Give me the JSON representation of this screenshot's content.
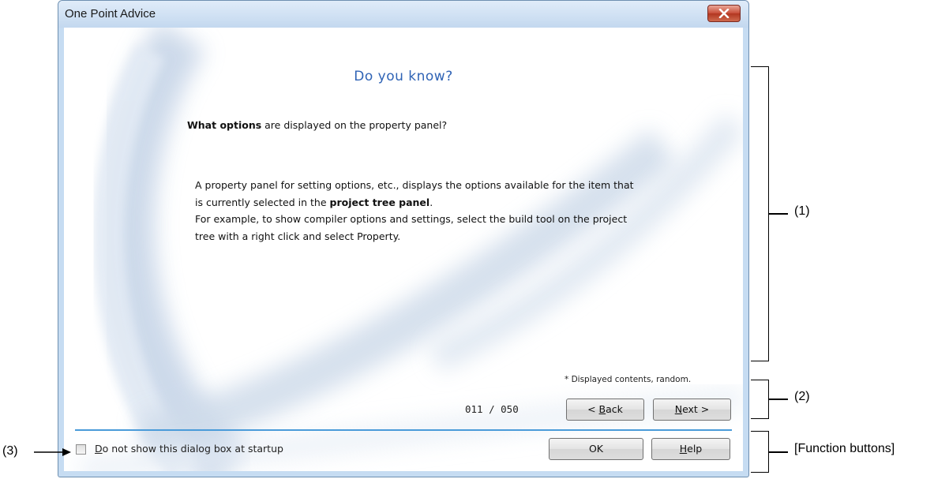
{
  "window": {
    "title": "One Point Advice",
    "close_icon": "close-icon"
  },
  "advice": {
    "heading": "Do you know?",
    "question_bold": "What options",
    "question_rest": " are displayed on the property panel?",
    "paragraph_part1": "A property panel for setting options, etc., displays the options available for the item that is currently selected in the ",
    "paragraph_bold": "project tree panel",
    "paragraph_part2": ".",
    "paragraph_line2": "For example, to show compiler options and settings, select the build tool on the project tree with a right click and select Property."
  },
  "navigation": {
    "random_note": "* Displayed contents, random.",
    "counter": "011 / 050",
    "back_mnemonic": "B",
    "back_rest": "ack",
    "back_prefix": "< ",
    "next_mnemonic": "N",
    "next_rest": "ext >"
  },
  "footer": {
    "checkbox_checked": false,
    "checkbox_mnemonic": "D",
    "checkbox_rest": "o not show this dialog box at startup",
    "ok_label": "OK",
    "help_mnemonic": "H",
    "help_rest": "elp"
  },
  "annotations": {
    "area1": "(1)",
    "area2": "(2)",
    "area3": "(3)",
    "function_buttons": "[Function buttons]"
  },
  "colors": {
    "heading": "#2f63b5",
    "separator": "#4a9bd9",
    "close_button": "#c9503b"
  }
}
